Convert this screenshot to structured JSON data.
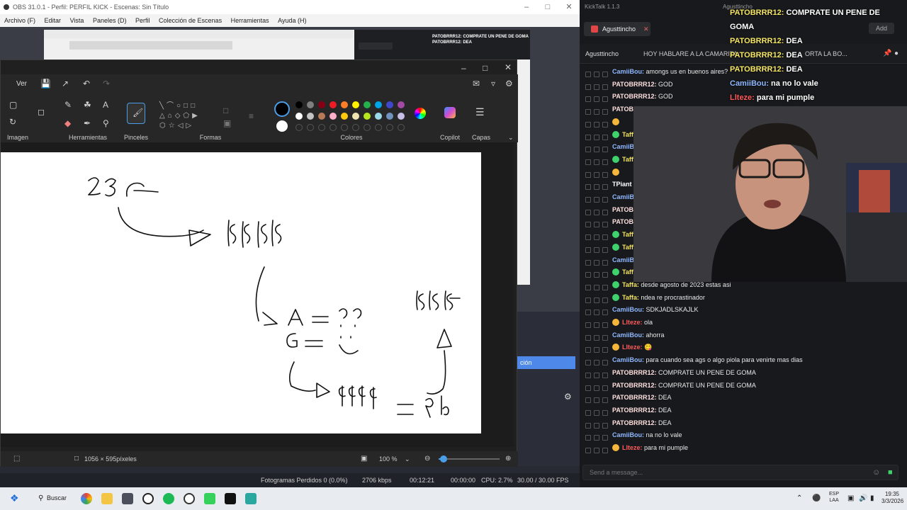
{
  "obs": {
    "title": "OBS 31.0.1 - Perfil: PERFIL KICK - Escenas: Sin Título",
    "menu": [
      "Archivo (F)",
      "Editar",
      "Vista",
      "Paneles (D)",
      "Perfil",
      "Colección de Escenas",
      "Herramientas",
      "Ayuda (H)"
    ],
    "nested_chat_lines": [
      "PATOBRRR12: COMPRATE UN PENE DE GOMA",
      "PATOBRRR12: DEA"
    ],
    "selected_item": "ción",
    "status": {
      "dropped_frames": "Fotogramas Perdidos 0 (0.0%)",
      "bitrate": "2706 kbps",
      "live_time": "00:12:21",
      "rec_time": "00:00:00",
      "cpu": "CPU: 2.7%",
      "fps": "30.00 / 30.00 FPS"
    }
  },
  "paint": {
    "menu_view": "Ver",
    "groups": {
      "image": "Imagen",
      "tools": "Herramientas",
      "brushes": "Pinceles",
      "shapes": "Formas",
      "colors": "Colores",
      "copilot": "Copilot",
      "layers": "Capas"
    },
    "palette_row1": [
      "#000000",
      "#7f7f7f",
      "#880015",
      "#ed1c24",
      "#ff7f27",
      "#fff200",
      "#22b14c",
      "#00a2e8",
      "#3f48cc",
      "#a349a4"
    ],
    "palette_row2": [
      "#ffffff",
      "#c3c3c3",
      "#b97a57",
      "#ffaec9",
      "#ffc90e",
      "#efe4b0",
      "#b5e61d",
      "#99d9ea",
      "#7092be",
      "#c8bfe7"
    ],
    "canvas_size": "1056 × 595píxeles",
    "zoom": "100 %",
    "zoom_fraction": 0.08
  },
  "chat": {
    "app_title": "KickTalk 1.1.3",
    "top_user": "Agusttincho",
    "tab_label": "Agusttincho",
    "add_label": "Add",
    "channel": "Agusttincho",
    "pinned": "HOY HABLARE A LA CAMARITA",
    "pinned_tail": "ORTA LA BO...",
    "overlay": [
      {
        "user": "PATOBRRR12:",
        "text": "COMPRATE UN PENE DE GOMA",
        "color": "#f5e663"
      },
      {
        "user": "PATOBRRR12:",
        "text": "DEA",
        "color": "#f5e663"
      },
      {
        "user": "PATOBRRR12:",
        "text": "DEA",
        "color": "#f5e663"
      },
      {
        "user": "PATOBRRR12:",
        "text": "DEA",
        "color": "#f5e663"
      },
      {
        "user": "CamiiBou:",
        "text": "na no lo vale",
        "color": "#8fb8ff"
      },
      {
        "user": "Llteze:",
        "text": "para mi pumple",
        "color": "#ff5a5a"
      }
    ],
    "messages": [
      {
        "user": "CamiiBou:",
        "text": "amongs us en buenos aires?",
        "color": "#8fb8ff",
        "badge": ""
      },
      {
        "user": "PATOBRRR12:",
        "text": "GOD",
        "color": "#ffe1e1",
        "badge": ""
      },
      {
        "user": "PATOBRRR12:",
        "text": "GOD",
        "color": "#ffe1e1",
        "badge": ""
      },
      {
        "user": "PATOB",
        "text": "",
        "color": "#ffe1e1",
        "badge": ""
      },
      {
        "user": "",
        "text": "",
        "color": "#ffe1e1",
        "badge": "#f5b73b"
      },
      {
        "user": "Taff",
        "text": "",
        "color": "#f5e663",
        "badge": "#3fd16b"
      },
      {
        "user": "CamiiB",
        "text": "",
        "color": "#8fb8ff",
        "badge": ""
      },
      {
        "user": "Taff",
        "text": "",
        "color": "#f5e663",
        "badge": "#3fd16b"
      },
      {
        "user": "",
        "text": "",
        "color": "#ffe1e1",
        "badge": "#f5b73b"
      },
      {
        "user": "TPiant",
        "text": "",
        "color": "#ffffff",
        "badge": ""
      },
      {
        "user": "CamiiB",
        "text": "",
        "color": "#8fb8ff",
        "badge": ""
      },
      {
        "user": "PATOB",
        "text": "",
        "color": "#ffe1e1",
        "badge": ""
      },
      {
        "user": "PATOB",
        "text": "",
        "color": "#ffe1e1",
        "badge": ""
      },
      {
        "user": "Taff",
        "text": "",
        "color": "#f5e663",
        "badge": "#3fd16b"
      },
      {
        "user": "Taff",
        "text": "",
        "color": "#f5e663",
        "badge": "#3fd16b"
      },
      {
        "user": "CamiiB",
        "text": "",
        "color": "#8fb8ff",
        "badge": ""
      },
      {
        "user": "Taff",
        "text": "",
        "color": "#f5e663",
        "badge": "#3fd16b"
      },
      {
        "user": "Taffa:",
        "text": "desde agosto de 2023 estas asi",
        "color": "#f5e663",
        "badge": "#3fd16b"
      },
      {
        "user": "Taffa:",
        "text": "ndea re procrastinador",
        "color": "#f5e663",
        "badge": "#3fd16b"
      },
      {
        "user": "CamiiBou:",
        "text": "SDKJADLSKAJLK",
        "color": "#8fb8ff",
        "badge": ""
      },
      {
        "user": "Llteze:",
        "text": "ola",
        "color": "#ff5a5a",
        "badge": "#f5b73b"
      },
      {
        "user": "CamiiBou:",
        "text": "ahorra",
        "color": "#8fb8ff",
        "badge": ""
      },
      {
        "user": "Llteze:",
        "text": "😋",
        "color": "#ff5a5a",
        "badge": "#f5b73b"
      },
      {
        "user": "CamiiBou:",
        "text": "para cuando sea ags o algo piola para venirte mas dias",
        "color": "#8fb8ff",
        "badge": ""
      },
      {
        "user": "PATOBRRR12:",
        "text": "COMPRATE UN PENE DE GOMA",
        "color": "#ffe1e1",
        "badge": ""
      },
      {
        "user": "PATOBRRR12:",
        "text": "COMPRATE UN PENE DE GOMA",
        "color": "#ffe1e1",
        "badge": ""
      },
      {
        "user": "PATOBRRR12:",
        "text": "DEA",
        "color": "#ffe1e1",
        "badge": ""
      },
      {
        "user": "PATOBRRR12:",
        "text": "DEA",
        "color": "#ffe1e1",
        "badge": ""
      },
      {
        "user": "PATOBRRR12:",
        "text": "DEA",
        "color": "#ffe1e1",
        "badge": ""
      },
      {
        "user": "CamiiBou:",
        "text": "na no lo vale",
        "color": "#8fb8ff",
        "badge": ""
      },
      {
        "user": "Llteze:",
        "text": "para mi pumple",
        "color": "#ff5a5a",
        "badge": "#f5b73b"
      }
    ],
    "input_placeholder": "Send a message..."
  },
  "taskbar": {
    "search_label": "Buscar",
    "lang_top": "ESP",
    "lang_bottom": "LAA",
    "time": "19:35",
    "date": "3/3/2026"
  }
}
